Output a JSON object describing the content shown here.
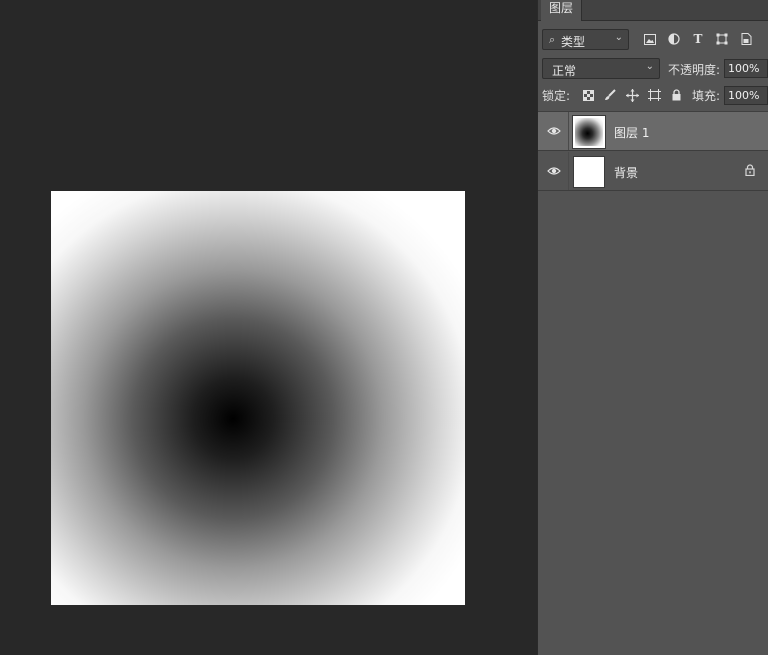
{
  "canvas": {
    "layer_content": "radial-gradient black center to white"
  },
  "layers_panel": {
    "tab_label": "图层",
    "filter": {
      "kind_label": "类型",
      "filter_icons": [
        "image-filter-icon",
        "adjustment-filter-icon",
        "type-filter-icon",
        "shape-filter-icon",
        "smart-object-filter-icon"
      ]
    },
    "blend_mode": "正常",
    "opacity_label": "不透明度:",
    "opacity_value": "100%",
    "lock_label": "锁定:",
    "lock_icons": [
      "lock-transparent-icon",
      "lock-image-icon",
      "lock-position-icon",
      "lock-artboard-icon",
      "lock-all-icon"
    ],
    "fill_label": "填充:",
    "fill_value": "100%",
    "layers": [
      {
        "name": "图层 1",
        "visible": true,
        "selected": true,
        "locked": false
      },
      {
        "name": "背景",
        "visible": true,
        "selected": false,
        "locked": true
      }
    ]
  }
}
